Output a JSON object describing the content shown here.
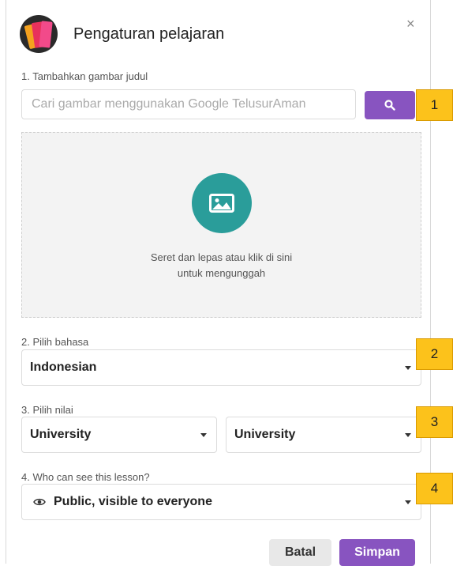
{
  "dialog": {
    "title": "Pengaturan pelajaran",
    "close_symbol": "×"
  },
  "image_section": {
    "label": "1. Tambahkan gambar judul",
    "search_placeholder": "Cari gambar menggunakan Google TelusurAman",
    "search_icon": "search-icon",
    "dropzone_icon": "image-icon",
    "dropzone_text_line1": "Seret dan lepas atau klik di sini",
    "dropzone_text_line2": "untuk mengunggah"
  },
  "language_section": {
    "label": "2. Pilih bahasa",
    "selected": "Indonesian"
  },
  "grade_section": {
    "label": "3. Pilih nilai",
    "from_selected": "University",
    "to_selected": "University"
  },
  "visibility_section": {
    "label": "4. Who can see this lesson?",
    "selected": "Public, visible to everyone",
    "icon": "eye-icon"
  },
  "footer": {
    "cancel_label": "Batal",
    "save_label": "Simpan"
  },
  "callouts": [
    "1",
    "2",
    "3",
    "4"
  ],
  "colors": {
    "accent": "#8854c0",
    "teal": "#2a9d9a",
    "callout": "#fcc21b"
  }
}
